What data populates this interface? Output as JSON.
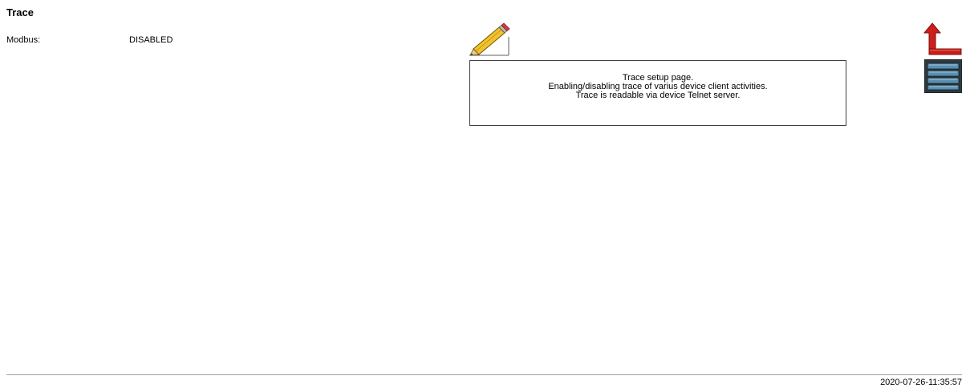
{
  "page": {
    "title": "Trace"
  },
  "settings": {
    "modbus_label": "Modbus:",
    "modbus_value": "DISABLED"
  },
  "info": {
    "line1": "Trace setup page.",
    "line2": "Enabling/disabling trace of varius device client activities.",
    "line3": "Trace is readable via device Telnet server."
  },
  "icons": {
    "edit": "pencil-icon",
    "back": "up-arrow-icon",
    "device": "server-rack-icon"
  },
  "footer": {
    "timestamp": "2020-07-26-11:35:57"
  },
  "colors": {
    "arrow_red": "#cc1f1a",
    "pencil_yellow": "#f2c12e",
    "server_blue": "#5a8fb0",
    "server_dark": "#2c3a42"
  }
}
